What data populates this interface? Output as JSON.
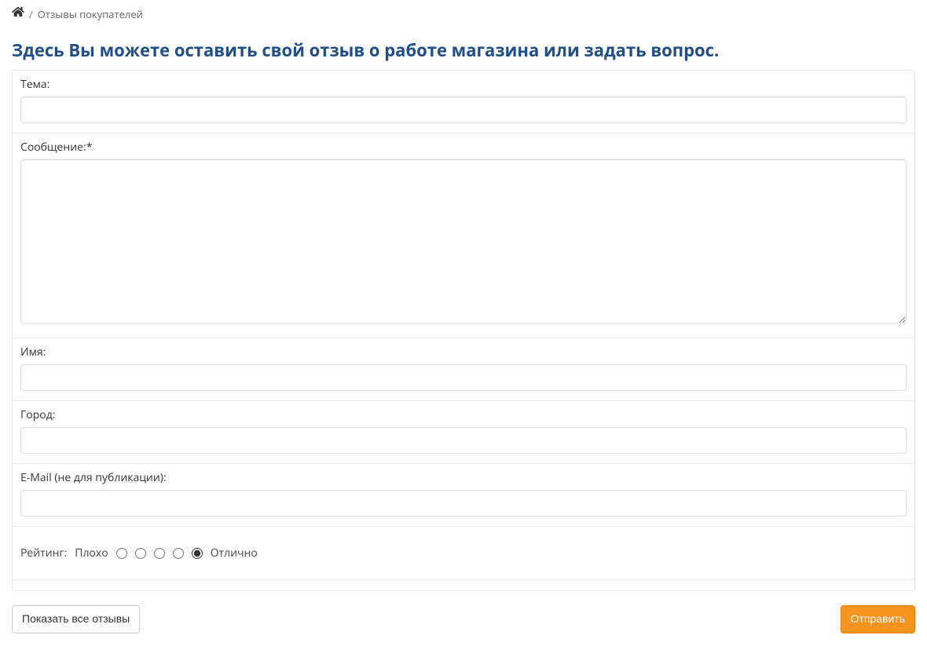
{
  "breadcrumb": {
    "current": "Отзывы покупателей"
  },
  "heading": "Здесь Вы можете оставить свой отзыв о работе магазина или задать вопрос.",
  "form": {
    "subject_label": "Тема:",
    "message_label": "Сообщение:*",
    "name_label": "Имя:",
    "city_label": "Город:",
    "email_label": "E-Mail (не для публикации):"
  },
  "rating": {
    "label": "Рейтинг:",
    "bad": "Плохо",
    "good": "Отлично",
    "selected": 5
  },
  "actions": {
    "show_all": "Показать все отзывы",
    "submit": "Отправить"
  }
}
